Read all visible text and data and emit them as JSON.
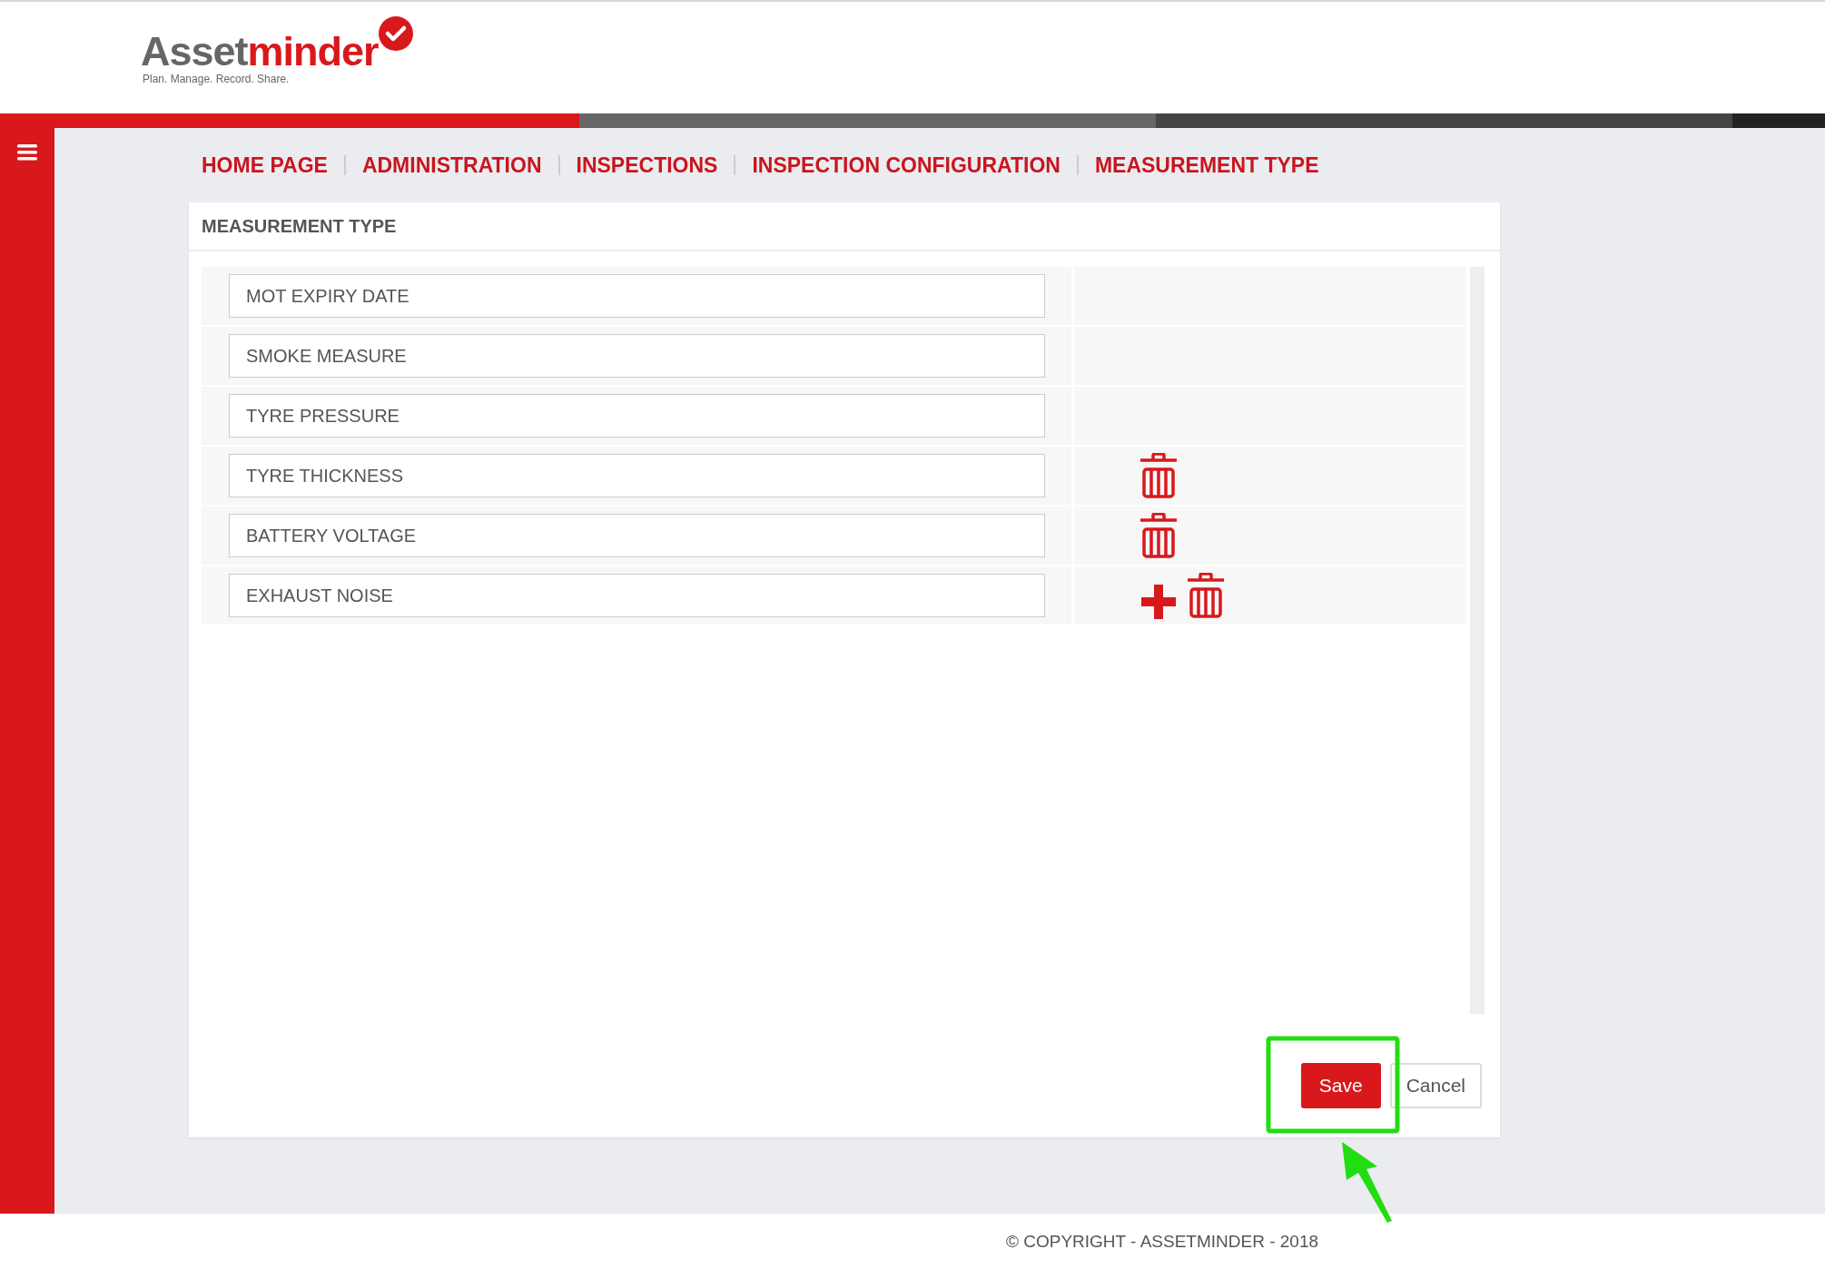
{
  "logo": {
    "name_start": "Asset",
    "name_end": "minder",
    "tagline": "Plan. Manage. Record. Share."
  },
  "breadcrumb": [
    "HOME PAGE",
    "ADMINISTRATION",
    "INSPECTIONS",
    "INSPECTION CONFIGURATION",
    "MEASUREMENT TYPE"
  ],
  "card": {
    "title": "MEASUREMENT TYPE",
    "rows": [
      {
        "value": "MOT EXPIRY DATE",
        "deletable": false,
        "addable": false
      },
      {
        "value": "SMOKE MEASURE",
        "deletable": false,
        "addable": false
      },
      {
        "value": "TYRE PRESSURE",
        "deletable": false,
        "addable": false
      },
      {
        "value": "TYRE THICKNESS",
        "deletable": true,
        "addable": false
      },
      {
        "value": "BATTERY VOLTAGE",
        "deletable": true,
        "addable": false
      },
      {
        "value": "EXHAUST NOISE",
        "deletable": true,
        "addable": true
      }
    ],
    "buttons": [
      {
        "label": "Save",
        "kind": "primary"
      },
      {
        "label": "Cancel",
        "kind": "secondary"
      }
    ]
  },
  "footer": "© COPYRIGHT - ASSETMINDER - 2018"
}
